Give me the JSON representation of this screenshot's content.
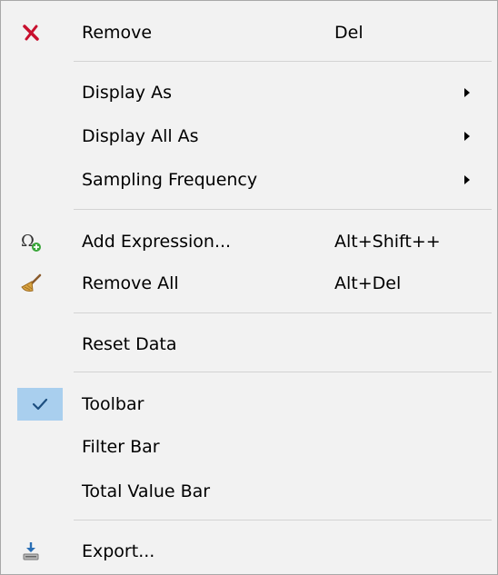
{
  "menu": {
    "items": [
      {
        "label": "Remove",
        "shortcut": "Del",
        "icon": "remove-icon"
      },
      {
        "label": "Display As",
        "submenu": true
      },
      {
        "label": "Display All As",
        "submenu": true
      },
      {
        "label": "Sampling Frequency",
        "submenu": true
      },
      {
        "label": "Add Expression...",
        "shortcut": "Alt+Shift++",
        "icon": "omega-add-icon"
      },
      {
        "label": "Remove All",
        "shortcut": "Alt+Del",
        "icon": "broom-icon"
      },
      {
        "label": "Reset Data"
      },
      {
        "label": "Toolbar",
        "checked": true,
        "icon": "checkmark-icon"
      },
      {
        "label": "Filter Bar"
      },
      {
        "label": "Total Value Bar"
      },
      {
        "label": "Export...",
        "icon": "export-icon"
      }
    ]
  },
  "colors": {
    "menu_bg": "#f2f2f2",
    "checked_bg": "#a9cfee",
    "remove_icon": "#c8102e",
    "separator": "#d3d3d3"
  }
}
